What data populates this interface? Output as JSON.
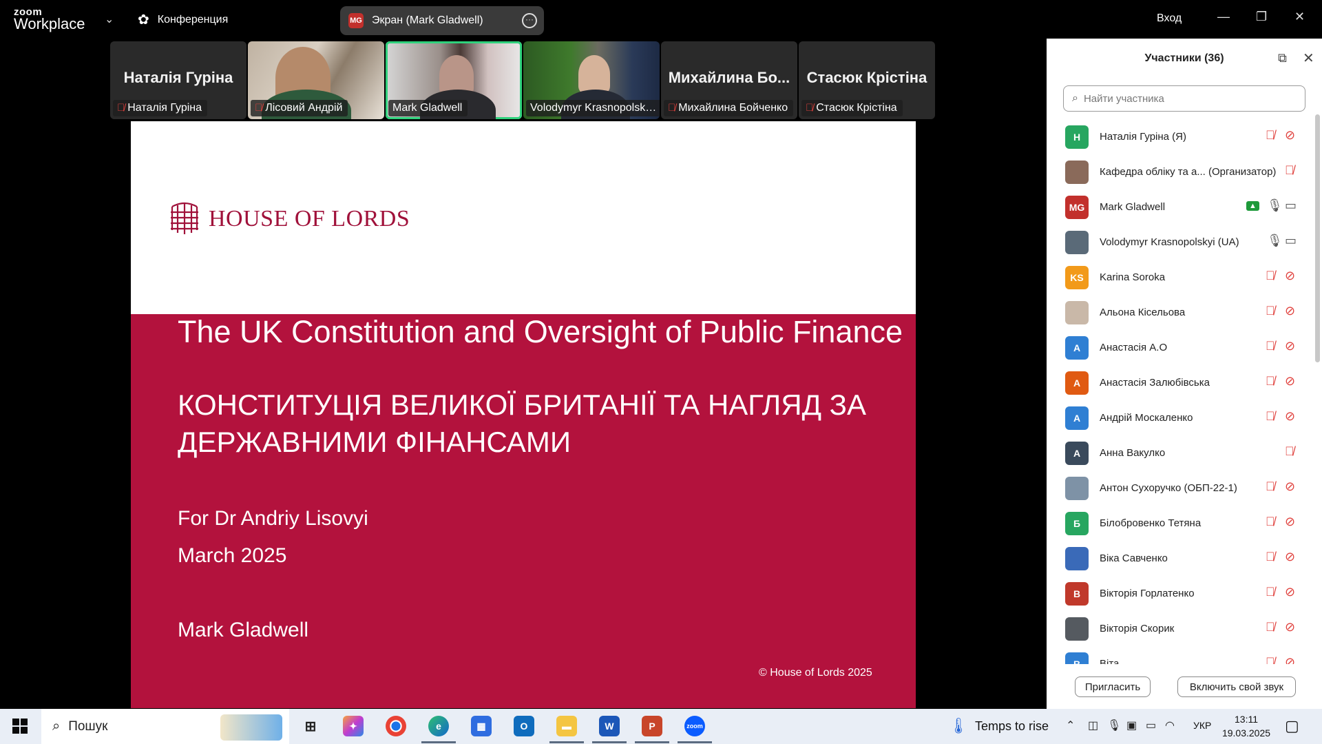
{
  "app": {
    "logo_top": "zoom",
    "logo_bottom": "Workplace",
    "meeting_label": "Конференция",
    "share_pill_initials": "MG",
    "share_pill_label": "Экран (Mark Gladwell)",
    "signin_label": "Вход"
  },
  "video_strip": [
    {
      "big_name": "Наталія Гуріна",
      "label": "Наталія Гуріна",
      "muted": true,
      "video": false
    },
    {
      "big_name": "",
      "label": "Лісовий Андрій",
      "muted": true,
      "video": true
    },
    {
      "big_name": "",
      "label": "Mark Gladwell",
      "muted": false,
      "video": true,
      "active": true
    },
    {
      "big_name": "",
      "label": "Volodymyr Krasnopolskyi ...",
      "muted": false,
      "video": true
    },
    {
      "big_name": "Михайлина  Бо...",
      "label": "Михайлина Бойченко",
      "muted": true,
      "video": false
    },
    {
      "big_name": "Стасюк Крістіна",
      "label": "Стасюк Крістіна",
      "muted": true,
      "video": false
    }
  ],
  "slide": {
    "brand": "HOUSE OF LORDS",
    "title_en": "The UK Constitution and Oversight of Public Finance",
    "title_ua": "КОНСТИТУЦІЯ ВЕЛИКОЇ БРИТАНІЇ ТА НАГЛЯД ЗА ДЕРЖАВНИМИ ФІНАНСАМИ",
    "for_line": "For Dr Andriy Lisovyi",
    "date_line": "March 2025",
    "author": "Mark Gladwell",
    "copyright": "© House of Lords 2025"
  },
  "participants_panel": {
    "title": "Участники (36)",
    "search_placeholder": "Найти участника",
    "invite_label": "Пригласить",
    "unmute_label": "Включить свой звук",
    "participants": [
      {
        "initials": "Н",
        "color": "#27a660",
        "name": "Наталія Гуріна (Я)",
        "mic": "off",
        "cam": "off"
      },
      {
        "initials": "",
        "color": "#8a6a5a",
        "name": "Кафедра обліку та а...  (Организатор)",
        "mic": "off",
        "cam": "none"
      },
      {
        "initials": "MG",
        "color": "#c2302c",
        "name": "Mark Gladwell",
        "mic": "on",
        "cam": "on",
        "sharing": true
      },
      {
        "initials": "",
        "color": "#5a6a78",
        "name": "Volodymyr Krasnopolskyi (UA)",
        "mic": "on",
        "cam": "on"
      },
      {
        "initials": "KS",
        "color": "#f29a1a",
        "name": "Karina Soroka",
        "mic": "off",
        "cam": "off"
      },
      {
        "initials": "",
        "color": "#c9b8a8",
        "name": "Альона Кісельова",
        "mic": "off",
        "cam": "off"
      },
      {
        "initials": "А",
        "color": "#2f7fd3",
        "name": "Анастасія А.О",
        "mic": "off",
        "cam": "off"
      },
      {
        "initials": "А",
        "color": "#e05a12",
        "name": "Анастасія Залюбівська",
        "mic": "off",
        "cam": "off"
      },
      {
        "initials": "А",
        "color": "#2f7fd3",
        "name": "Андрій Москаленко",
        "mic": "off",
        "cam": "off"
      },
      {
        "initials": "А",
        "color": "#3a4a5c",
        "name": "Анна Вакулко",
        "mic": "off",
        "cam": "none"
      },
      {
        "initials": "",
        "color": "#7e92a6",
        "name": "Антон Сухоручко (ОБП-22-1)",
        "mic": "off",
        "cam": "off"
      },
      {
        "initials": "Б",
        "color": "#27a660",
        "name": "Білобровенко Тетяна",
        "mic": "off",
        "cam": "off"
      },
      {
        "initials": "",
        "color": "#3a6ab8",
        "name": "Віка Савченко",
        "mic": "off",
        "cam": "off"
      },
      {
        "initials": "В",
        "color": "#c0392b",
        "name": "Вікторія Горлатенко",
        "mic": "off",
        "cam": "off"
      },
      {
        "initials": "",
        "color": "#555a60",
        "name": "Вікторія Скорик",
        "mic": "off",
        "cam": "off"
      },
      {
        "initials": "В",
        "color": "#2f7fd3",
        "name": "Віта",
        "mic": "off",
        "cam": "off"
      }
    ]
  },
  "taskbar": {
    "search_label": "Пошук",
    "weather_label": "Temps to rise",
    "language": "УКР",
    "time": "13:11",
    "date": "19.03.2025"
  },
  "icons": {
    "muted": "microphone-off-icon",
    "camera_off": "camera-off-icon"
  }
}
